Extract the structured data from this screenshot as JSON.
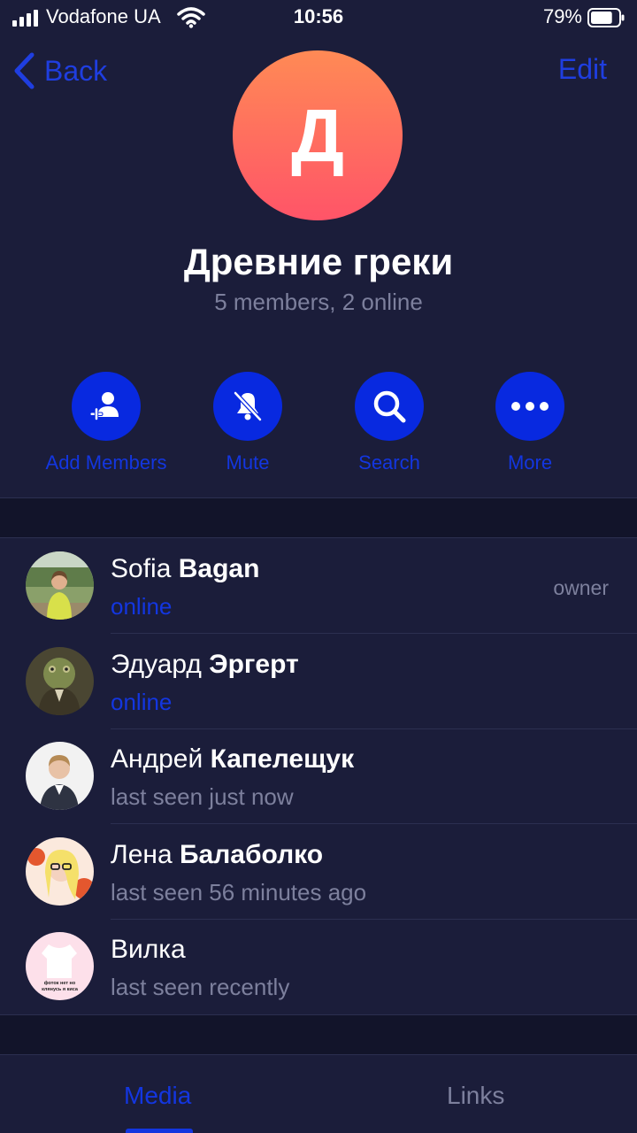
{
  "status_bar": {
    "carrier": "Vodafone UA",
    "time": "10:56",
    "battery": "79%",
    "battery_level": 0.79
  },
  "nav": {
    "back_label": "Back",
    "edit_label": "Edit"
  },
  "group": {
    "avatar_letter": "Д",
    "title": "Древние греки",
    "subtitle": "5 members, 2 online"
  },
  "actions": [
    {
      "label": "Add Members",
      "icon": "add-member-icon"
    },
    {
      "label": "Mute",
      "icon": "bell-slash-icon"
    },
    {
      "label": "Search",
      "icon": "search-icon"
    },
    {
      "label": "More",
      "icon": "more-dots-icon"
    }
  ],
  "members": [
    {
      "first": "Sofia",
      "last": "Bagan",
      "status": "online",
      "online": true,
      "role": "owner"
    },
    {
      "first": "Эдуард",
      "last": "Эргерт",
      "status": "online",
      "online": true,
      "role": ""
    },
    {
      "first": "Андрей",
      "last": "Капелещук",
      "status": "last seen just now",
      "online": false,
      "role": ""
    },
    {
      "first": "Лена",
      "last": "Балаболко",
      "status": "last seen 56 minutes ago",
      "online": false,
      "role": ""
    },
    {
      "first": "Вилка",
      "last": "",
      "status": "last seen recently",
      "online": false,
      "role": "",
      "avatar_caption": "фоток нет но клянусь я киса"
    }
  ],
  "tabs": {
    "media": "Media",
    "links": "Links"
  },
  "colors": {
    "background": "#1b1d3a",
    "accent": "#1336e0",
    "secondary_text": "#7d809d",
    "avatar_gradient_top": "#ff8a55",
    "avatar_gradient_bottom": "#ff5468"
  }
}
